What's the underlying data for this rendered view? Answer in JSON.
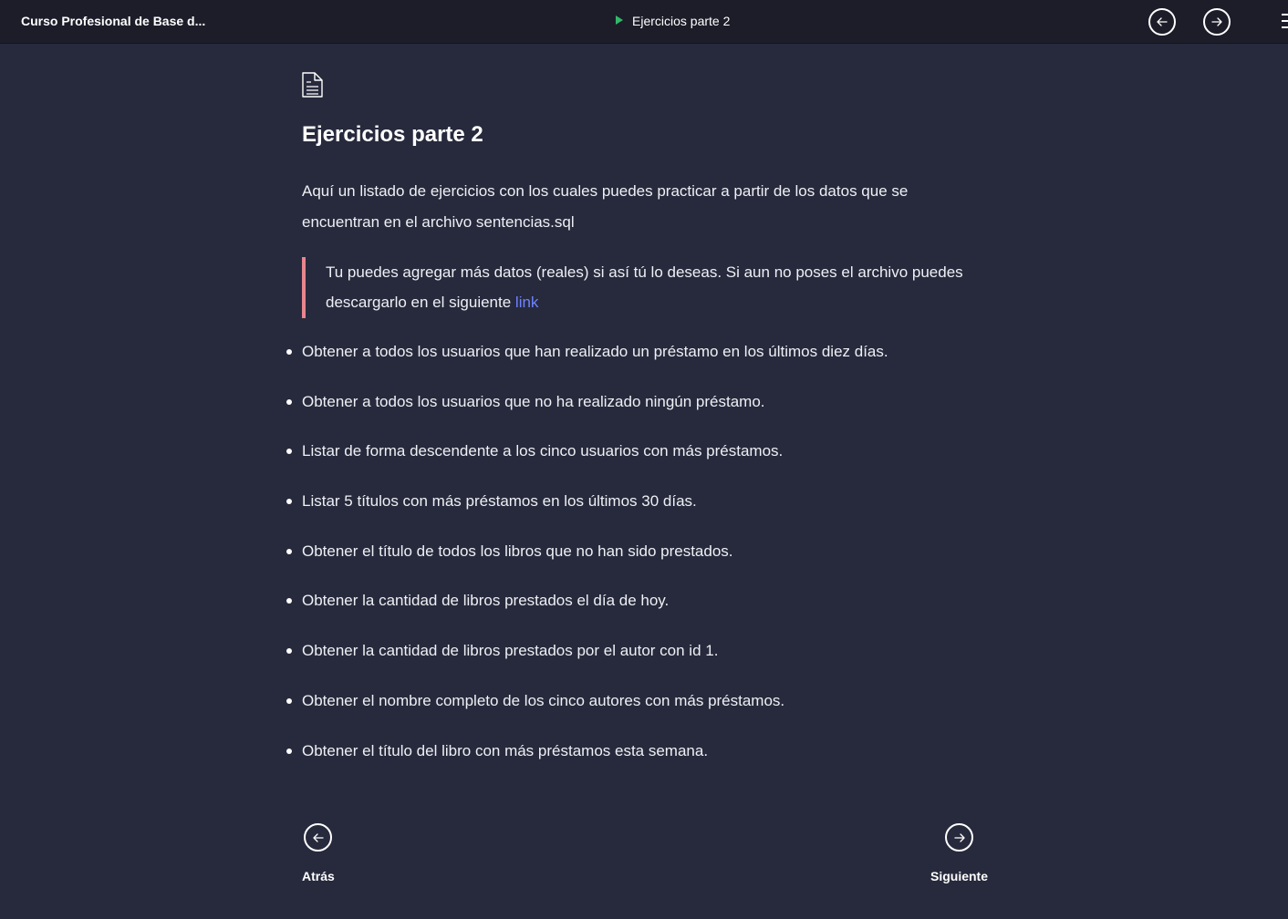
{
  "header": {
    "course_title": "Curso Profesional de Base d...",
    "current_lesson": "Ejercicios parte 2"
  },
  "content": {
    "title": "Ejercicios parte 2",
    "intro": "Aquí un listado de ejercicios con los cuales puedes practicar a partir de los datos que se encuentran en el archivo sentencias.sql",
    "callout": {
      "text": "Tu puedes agregar más datos (reales) si así tú lo deseas. Si aun no poses el archivo puedes descargarlo en el siguiente",
      "link_text": "link"
    },
    "exercises": [
      "Obtener a todos los usuarios que han realizado un préstamo en los últimos diez días.",
      "Obtener a todos los usuarios que no ha realizado ningún préstamo.",
      "Listar de forma descendente a los cinco usuarios con más préstamos.",
      "Listar 5 títulos con más préstamos en los últimos 30 días.",
      "Obtener el título de todos los libros que no han sido prestados.",
      "Obtener la cantidad de libros prestados el día de hoy.",
      "Obtener la cantidad de libros prestados por el autor con id 1.",
      "Obtener el nombre completo de los cinco autores con más préstamos.",
      "Obtener el título del libro con más préstamos esta semana."
    ]
  },
  "navigation": {
    "back_label": "Atrás",
    "next_label": "Siguiente"
  },
  "colors": {
    "background": "#272a3c",
    "header": "#1c1d29",
    "play_accent": "#33b86a",
    "callout_border": "#e7868d",
    "link": "#6f83ff"
  },
  "icons": [
    "play-icon",
    "arrow-left-icon",
    "arrow-right-icon",
    "menu-icon",
    "document-icon"
  ]
}
